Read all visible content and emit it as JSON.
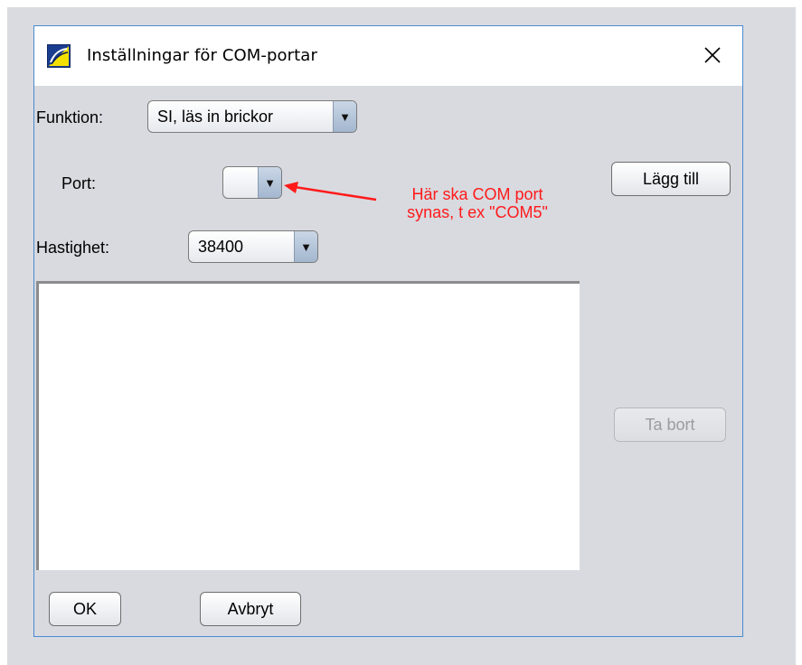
{
  "window": {
    "title": "Inställningar för COM-portar",
    "close_symbol": "✕"
  },
  "form": {
    "function_label": "Funktion:",
    "function_value": "SI, läs in brickor",
    "port_label": "Port:",
    "port_value": "",
    "speed_label": "Hastighet:",
    "speed_value": "38400"
  },
  "buttons": {
    "add": "Lägg till",
    "remove": "Ta bort",
    "ok": "OK",
    "cancel": "Avbryt"
  },
  "annotation": {
    "line1": "Här ska COM port",
    "line2": "synas, t ex \"COM5\"",
    "color": "#ff1a1a"
  },
  "icons": {
    "app": "app-logo-icon",
    "close": "close-icon",
    "dropdown": "chevron-down-icon"
  },
  "colors": {
    "dialog_bg": "#d8dae0",
    "window_border": "#4a8bd0",
    "combo_arrow": "#a3b7cf"
  }
}
